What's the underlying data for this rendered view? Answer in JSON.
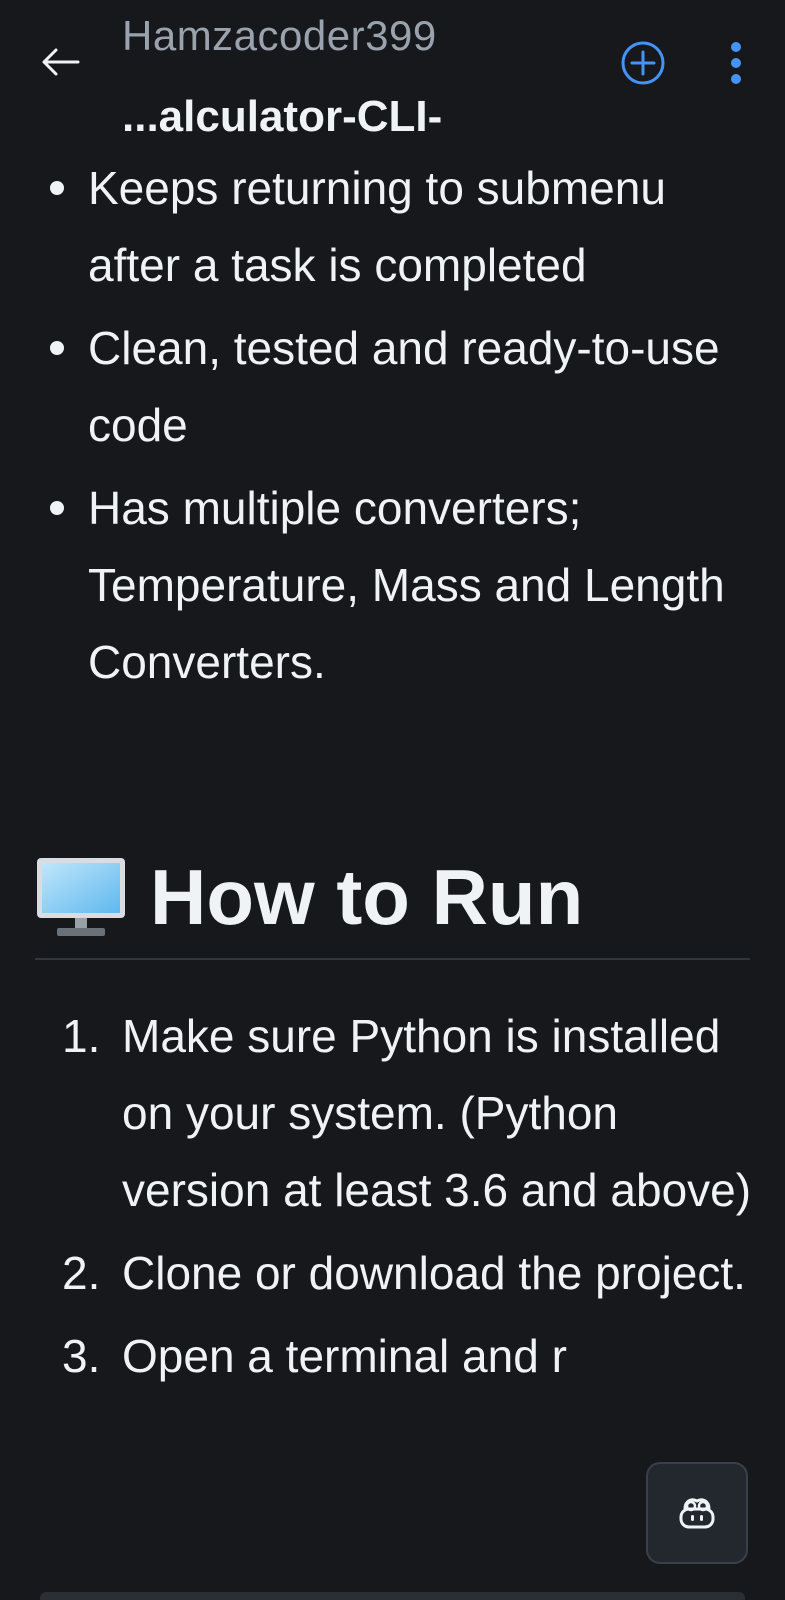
{
  "header": {
    "owner": "Hamzacoder399",
    "repo": "...alculator-CLI-"
  },
  "features": [
    "Keeps returning to submenu after a task is completed",
    "Clean, tested and ready-to-use code",
    "Has multiple converters; Temperature, Mass and Length Converters."
  ],
  "section": {
    "title": "How to Run"
  },
  "steps": [
    {
      "num": "1.",
      "text": "Make sure Python is installed on your system. (Python version at least 3.6 and above)"
    },
    {
      "num": "2.",
      "text": "Clone or download the project."
    },
    {
      "num": "3.",
      "text": "Open a terminal and r"
    }
  ],
  "colors": {
    "background": "#16181c",
    "text": "#f0f3f6",
    "muted": "#9aa3ad",
    "accent": "#4493f8"
  },
  "icons": [
    "arrow-left-icon",
    "plus-circle-icon",
    "kebab-menu-icon",
    "desktop-computer-icon",
    "copilot-icon"
  ]
}
